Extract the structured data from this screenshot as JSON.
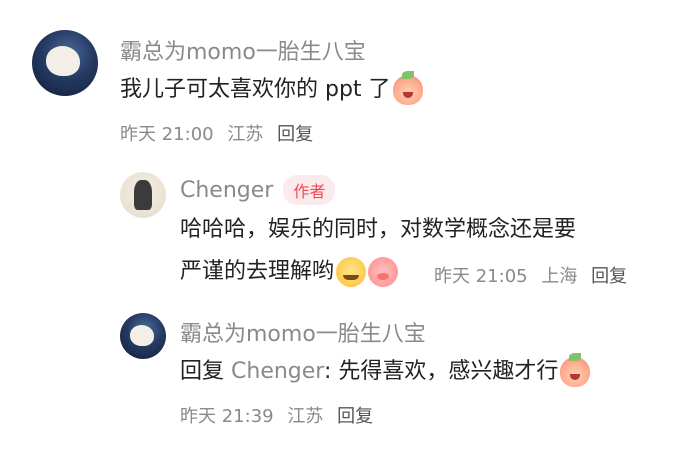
{
  "comments": [
    {
      "author": "霸总为momo一胎生八宝",
      "text": "我儿子可太喜欢你的 ppt 了",
      "emojis": [
        "crying-laugh-peach-emoji"
      ],
      "time": "昨天 21:00",
      "location": "江苏",
      "reply_label": "回复"
    }
  ],
  "replies": [
    {
      "author": "Chenger",
      "badge": "作者",
      "text_line1": "哈哈哈，娱乐的同时，对数学概念还是要",
      "text_line2": "严谨的去理解哟",
      "emojis": [
        "smile-emoji",
        "pig-emoji"
      ],
      "time": "昨天 21:05",
      "location": "上海",
      "reply_label": "回复"
    },
    {
      "author": "霸总为momo一胎生八宝",
      "reply_prefix": "回复",
      "reply_target": "Chenger",
      "text": ": 先得喜欢，感兴趣才行",
      "emojis": [
        "crying-laugh-peach-emoji"
      ],
      "time": "昨天 21:39",
      "location": "江苏",
      "reply_label": "回复"
    }
  ],
  "colors": {
    "muted": "#8a8a8a",
    "text": "#222222",
    "badge_text": "#ef4a57",
    "badge_bg": "#fdeaec"
  }
}
